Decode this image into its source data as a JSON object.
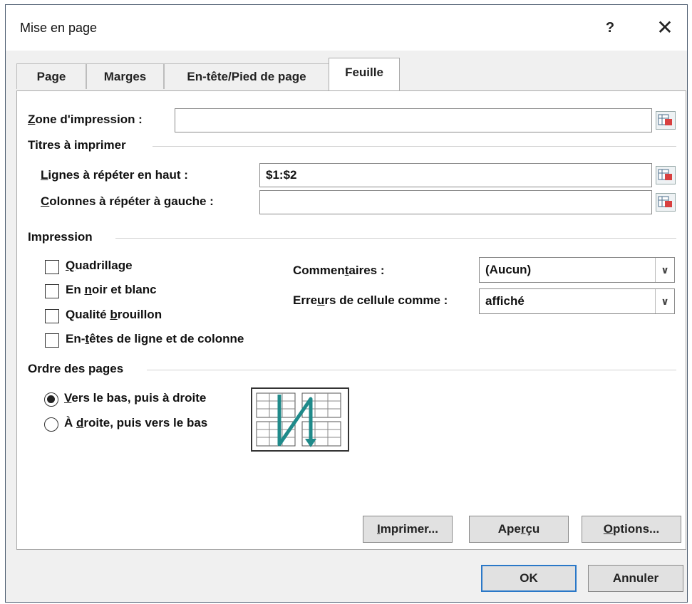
{
  "dialog": {
    "title": "Mise en page",
    "help_label": "?",
    "close_label": "✕"
  },
  "tabs": [
    {
      "label": "Page",
      "active": false
    },
    {
      "label": "Marges",
      "active": false
    },
    {
      "label": "En-tête/Pied de page",
      "active": false
    },
    {
      "label": "Feuille",
      "active": true
    }
  ],
  "print_area": {
    "label_ul": "Z",
    "label_rest": "one d'impression :",
    "value": ""
  },
  "print_titles": {
    "heading": "Titres à imprimer",
    "rows_label_ul": "L",
    "rows_label_rest": "ignes à répéter en haut :",
    "rows_value": "$1:$2",
    "cols_label_ul": "C",
    "cols_label_rest": "olonnes à répéter à gauche :",
    "cols_value": ""
  },
  "printing": {
    "heading": "Impression",
    "gridlines": {
      "ul": "Q",
      "rest": "uadrillage",
      "checked": false
    },
    "bw": {
      "pre": "En ",
      "ul": "n",
      "rest": "oir et blanc",
      "checked": false
    },
    "draft": {
      "pre": "Qualité ",
      "ul": "b",
      "rest": "rouillon",
      "checked": false
    },
    "headings": {
      "pre": "En-",
      "ul": "t",
      "rest": "êtes de ligne et de colonne",
      "checked": false
    },
    "comments": {
      "pre": "Commen",
      "ul": "t",
      "rest": "aires :",
      "value": "(Aucun)"
    },
    "errors": {
      "pre": "Erre",
      "ul": "u",
      "rest": "rs de cellule comme :",
      "value": "affiché"
    }
  },
  "page_order": {
    "heading": "Ordre des pages",
    "down_then_over": {
      "ul": "V",
      "rest": "ers le bas, puis à droite",
      "selected": true
    },
    "over_then_down": {
      "pre": "À ",
      "ul": "d",
      "rest": "roite, puis vers le bas",
      "selected": false
    }
  },
  "buttons": {
    "print": {
      "ul": "I",
      "rest": "mprimer..."
    },
    "preview": {
      "pre": "Ape",
      "ul": "r",
      "rest": "çu"
    },
    "options": {
      "ul": "O",
      "rest": "ptions..."
    },
    "ok": "OK",
    "cancel": "Annuler"
  },
  "colors": {
    "accent": "#2a78c8",
    "arrow": "#1f8a8a"
  }
}
